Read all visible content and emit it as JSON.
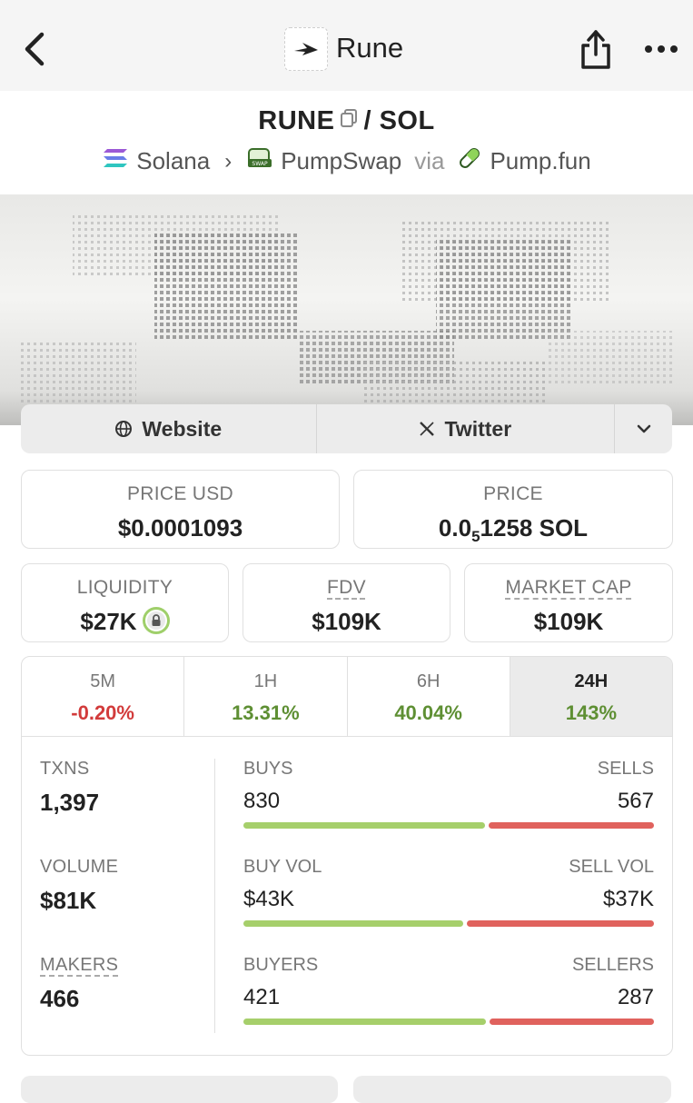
{
  "nav": {
    "title": "Rune",
    "back_icon": "chevron-left-icon",
    "share_icon": "share-icon",
    "more_icon": "more-horizontal-icon"
  },
  "pair": {
    "base": "RUNE",
    "separator": "/",
    "quote": "SOL",
    "chain": "Solana",
    "dex": "PumpSwap",
    "via": "via",
    "launchpad": "Pump.fun"
  },
  "links": {
    "website": "Website",
    "twitter": "Twitter"
  },
  "stats": {
    "price_usd_label": "PRICE USD",
    "price_usd": "$0.0001093",
    "price_label": "PRICE",
    "price_prefix": "0.0",
    "price_zeros": "5",
    "price_suffix": "1258 SOL",
    "liquidity_label": "LIQUIDITY",
    "liquidity": "$27K",
    "fdv_label": "FDV",
    "fdv": "$109K",
    "mcap_label": "MARKET CAP",
    "mcap": "$109K"
  },
  "timeframes": [
    {
      "label": "5M",
      "value": "-0.20%",
      "trend": "neg"
    },
    {
      "label": "1H",
      "value": "13.31%",
      "trend": "pos"
    },
    {
      "label": "6H",
      "value": "40.04%",
      "trend": "pos"
    },
    {
      "label": "24H",
      "value": "143%",
      "trend": "pos",
      "active": true
    }
  ],
  "activity": {
    "txns_label": "TXNS",
    "txns": "1,397",
    "volume_label": "VOLUME",
    "volume": "$81K",
    "makers_label": "MAKERS",
    "makers": "466",
    "buys_label": "BUYS",
    "buys": "830",
    "sells_label": "SELLS",
    "sells": "567",
    "buy_vol_label": "BUY VOL",
    "buy_vol": "$43K",
    "sell_vol_label": "SELL VOL",
    "sell_vol": "$37K",
    "buyers_label": "BUYERS",
    "buyers": "421",
    "sellers_label": "SELLERS",
    "sellers": "287",
    "buys_share": 0.594,
    "buy_vol_share": 0.54,
    "buyers_share": 0.595
  },
  "colors": {
    "positive": "#5e8f33",
    "negative": "#d23b3b",
    "buy_bar": "#a6cf6b",
    "sell_bar": "#e0625d"
  }
}
